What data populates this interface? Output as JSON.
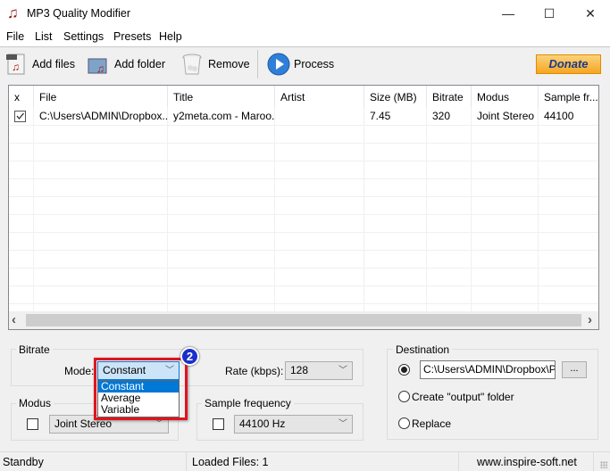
{
  "window": {
    "title": "MP3 Quality Modifier",
    "minimize": "—",
    "maximize": "☐",
    "close": "✕"
  },
  "menu": [
    "File",
    "List",
    "Settings",
    "Presets",
    "Help"
  ],
  "toolbar": {
    "add_files": "Add files",
    "add_folder": "Add folder",
    "remove": "Remove",
    "process": "Process",
    "donate": "Donate"
  },
  "list": {
    "columns": [
      "x",
      "File",
      "Title",
      "Artist",
      "Size  (MB)",
      "Bitrate",
      "Modus",
      "Sample fr..."
    ],
    "rows": [
      {
        "checked": true,
        "file": "C:\\Users\\ADMIN\\Dropbox...",
        "title": "y2meta.com - Maroo...",
        "artist": "",
        "size": "7.45",
        "bitrate": "320",
        "modus": "Joint Stereo",
        "sample": "44100"
      }
    ],
    "scroll_left": "‹",
    "scroll_right": "›"
  },
  "bitrate": {
    "legend": "Bitrate",
    "mode_label": "Mode:",
    "mode_value": "Constant",
    "mode_options": [
      "Constant",
      "Average",
      "Variable"
    ],
    "rate_label": "Rate (kbps):",
    "rate_value": "128",
    "badge": "2"
  },
  "modus": {
    "legend": "Modus",
    "value": "Joint Stereo"
  },
  "sample": {
    "legend": "Sample frequency",
    "value": "44100 Hz"
  },
  "destination": {
    "legend": "Destination",
    "path": "C:\\Users\\ADMIN\\Dropbox\\PC",
    "browse": "...",
    "create_output": "Create \"output\" folder",
    "replace": "Replace"
  },
  "status": {
    "state": "Standby",
    "loaded": "Loaded Files: 1",
    "website": "www.inspire-soft.net"
  },
  "colors": {
    "highlight": "#0078d7",
    "annotation": "#e0141e",
    "donate": "#f5a623"
  }
}
